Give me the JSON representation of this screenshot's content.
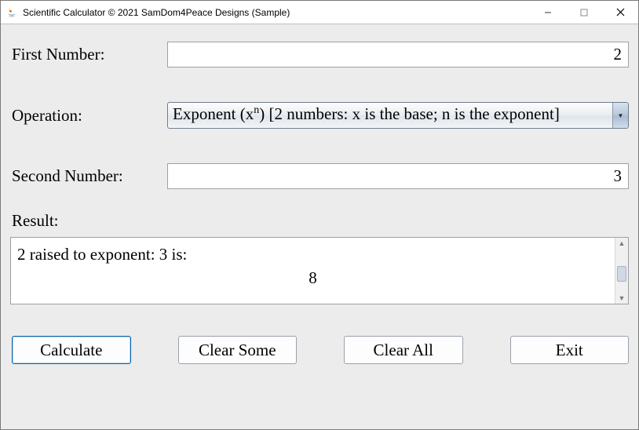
{
  "window": {
    "title": "Scientific Calculator © 2021 SamDom4Peace Designs (Sample)"
  },
  "labels": {
    "first": "First Number:",
    "operation": "Operation:",
    "second": "Second Number:",
    "result": "Result:"
  },
  "inputs": {
    "first_value": "2",
    "second_value": "3"
  },
  "operation": {
    "selected_html": "Exponent (x<sup>n</sup>) [2 numbers: x is the base; n is the exponent]"
  },
  "result": {
    "line1": "2 raised to exponent: 3 is:",
    "line2": "8"
  },
  "buttons": {
    "calculate": "Calculate",
    "clear_some": "Clear Some",
    "clear_all": "Clear All",
    "exit": "Exit"
  }
}
